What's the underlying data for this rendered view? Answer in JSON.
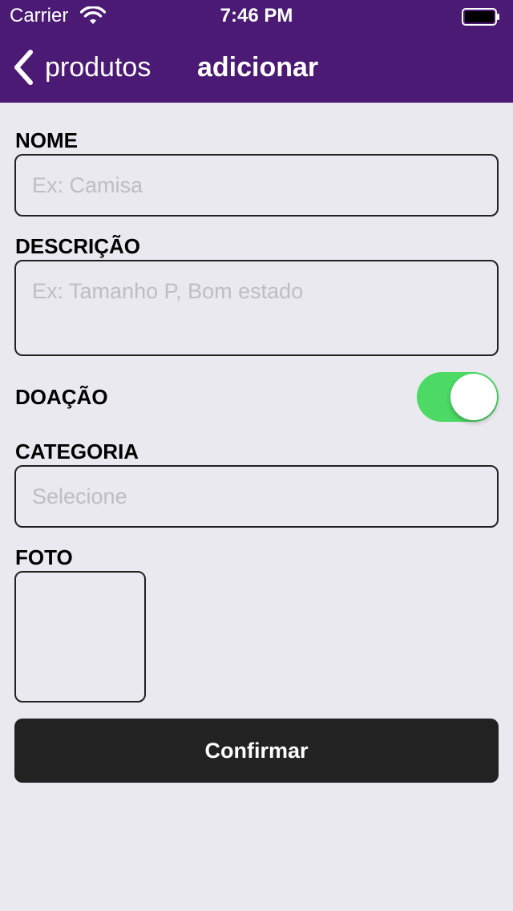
{
  "status_bar": {
    "carrier": "Carrier",
    "time": "7:46 PM",
    "wifi_icon": "wifi-icon",
    "battery_icon": "battery-icon"
  },
  "nav": {
    "back_label": "produtos",
    "back_icon": "chevron-left-icon",
    "title": "adicionar"
  },
  "form": {
    "nome": {
      "label": "NOME",
      "value": "",
      "placeholder": "Ex: Camisa"
    },
    "descricao": {
      "label": "DESCRIÇÃO",
      "value": "",
      "placeholder": "Ex: Tamanho P, Bom estado"
    },
    "doacao": {
      "label": "DOAÇÃO",
      "on": true
    },
    "categoria": {
      "label": "CATEGORIA",
      "value": "",
      "placeholder": "Selecione"
    },
    "foto": {
      "label": "FOTO"
    },
    "confirm_label": "Confirmar"
  },
  "colors": {
    "header": "#4A1A75",
    "background": "#EAE9EF",
    "toggle_on": "#4CD964",
    "button": "#222222"
  }
}
